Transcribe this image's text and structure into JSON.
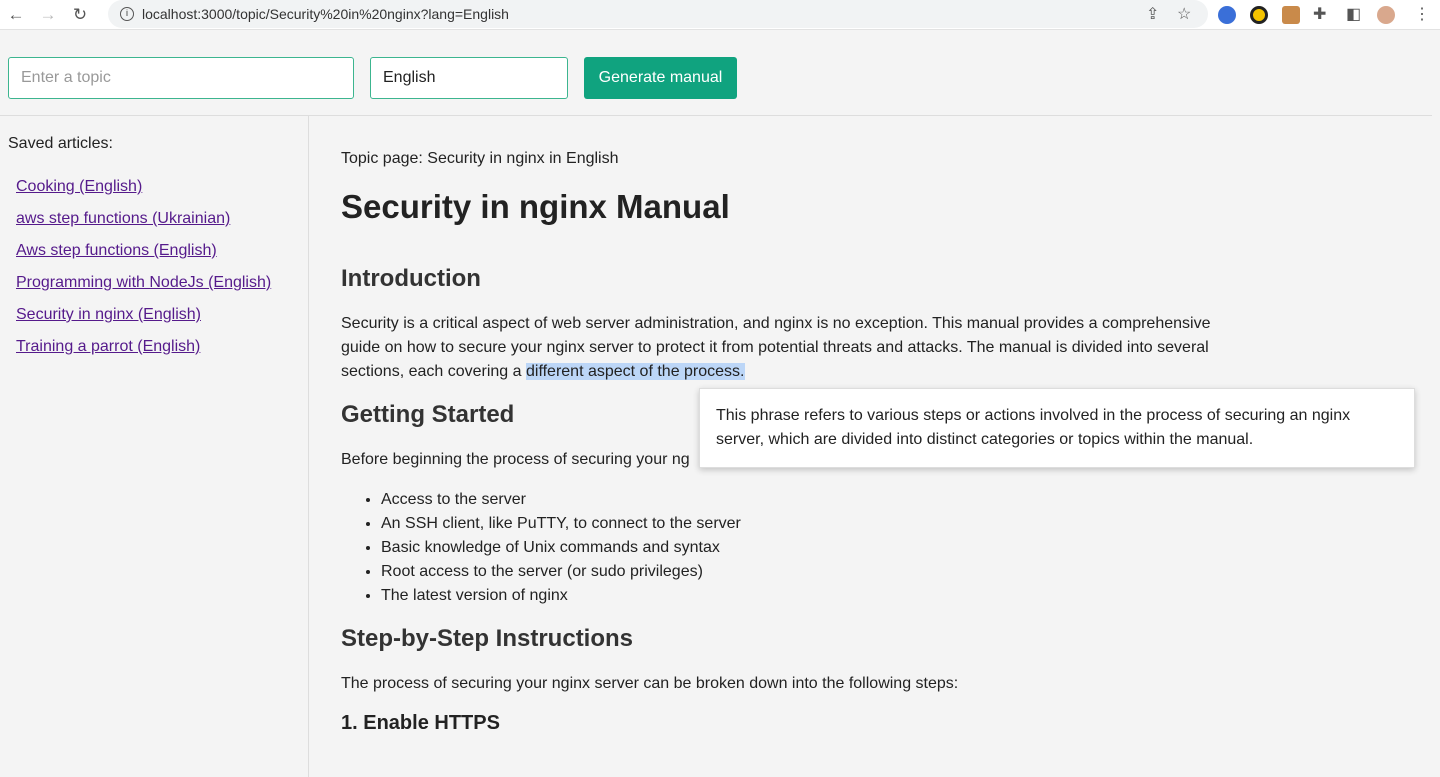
{
  "browser": {
    "url": "localhost:3000/topic/Security%20in%20nginx?lang=English"
  },
  "form": {
    "topic_placeholder": "Enter a topic",
    "language": "English",
    "generate_label": "Generate manual"
  },
  "sidebar": {
    "title": "Saved articles:",
    "items": [
      "Cooking (English)",
      "aws step functions (Ukrainian)",
      "Aws step functions (English)",
      "Programming with NodeJs (English)",
      "Security in nginx (English)",
      "Training a parrot (English)"
    ]
  },
  "main": {
    "topic_line": "Topic page: Security in nginx in English",
    "title": "Security in nginx Manual",
    "intro_heading": "Introduction",
    "intro_text": "Security is a critical aspect of web server administration, and nginx is no exception. This manual provides a comprehensive guide on how to secure your nginx server to protect it from potential threats and attacks. The manual is divided into several sections, each covering a",
    "intro_highlight": "different aspect of the process.",
    "gs_heading": "Getting Started",
    "gs_text": "Before beginning the process of securing your ng",
    "gs_items": [
      "Access to the server",
      "An SSH client, like PuTTY, to connect to the server",
      "Basic knowledge of Unix commands and syntax",
      "Root access to the server (or sudo privileges)",
      "The latest version of nginx"
    ],
    "steps_heading": "Step-by-Step Instructions",
    "steps_text": "The process of securing your nginx server can be broken down into the following steps:",
    "step1": "1. Enable HTTPS"
  },
  "tooltip": "This phrase refers to various steps or actions involved in the process of securing an nginx server, which are divided into distinct categories or topics within the manual."
}
